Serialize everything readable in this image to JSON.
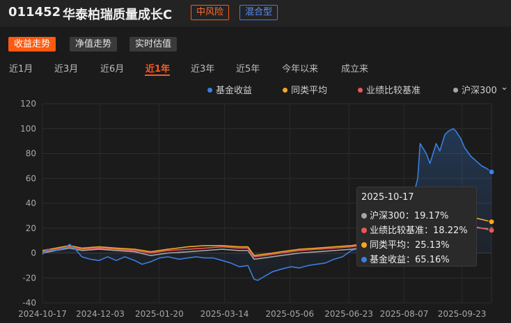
{
  "fund": {
    "code": "011452",
    "name": "华泰柏瑞质量成长C",
    "risk": "中风险",
    "type": "混合型"
  },
  "tabs": [
    "收益走势",
    "净值走势",
    "实时估值"
  ],
  "periods": [
    "近1月",
    "近3月",
    "近6月",
    "近1年",
    "近3年",
    "近5年",
    "今年以来",
    "成立来"
  ],
  "active_period": "近1年",
  "colors": {
    "fund": "#3a7fe0",
    "peer": "#f5a623",
    "benchmark": "#e85858",
    "hs300": "#a6a6a6",
    "accent": "#ff5a1f"
  },
  "tooltip": {
    "date": "2025-10-17",
    "rows": [
      {
        "label": "沪深300",
        "value": "19.17%",
        "color": "#a6a6a6"
      },
      {
        "label": "业绩比较基准",
        "value": "18.22%",
        "color": "#e85858"
      },
      {
        "label": "同类平均",
        "value": "25.13%",
        "color": "#f5a623"
      },
      {
        "label": "基金收益",
        "value": "65.16%",
        "color": "#3a7fe0"
      }
    ]
  },
  "chart_data": {
    "type": "line",
    "yticks": [
      "120",
      "100",
      "80",
      "60",
      "40",
      "20",
      "0",
      "-20",
      "-40"
    ],
    "xticks": [
      "2024-10-17",
      "2024-12-03",
      "2025-01-20",
      "2025-03-14",
      "2025-05-06",
      "2025-06-23",
      "2025-08-07",
      "2025-09-23"
    ],
    "ylim": [
      -40,
      120
    ],
    "xlim": [
      "2024-10-17",
      "2025-10-17"
    ],
    "grid": true,
    "legend_position": "top-right",
    "series": [
      {
        "name": "基金收益",
        "color": "#3a7fe0",
        "fill": true,
        "points": [
          [
            "2024-10-17",
            -1
          ],
          [
            "2024-10-21",
            3
          ],
          [
            "2024-10-28",
            2
          ],
          [
            "2024-11-04",
            4
          ],
          [
            "2024-11-08",
            7
          ],
          [
            "2024-11-13",
            3
          ],
          [
            "2024-11-18",
            -3
          ],
          [
            "2024-11-25",
            -5
          ],
          [
            "2024-12-02",
            -6
          ],
          [
            "2024-12-09",
            -3
          ],
          [
            "2024-12-16",
            -6
          ],
          [
            "2024-12-23",
            -3
          ],
          [
            "2024-12-31",
            -6
          ],
          [
            "2025-01-06",
            -9
          ],
          [
            "2025-01-13",
            -7
          ],
          [
            "2025-01-20",
            -4
          ],
          [
            "2025-01-27",
            -3
          ],
          [
            "2025-02-05",
            -5
          ],
          [
            "2025-02-12",
            -4
          ],
          [
            "2025-02-19",
            -3
          ],
          [
            "2025-02-26",
            -4
          ],
          [
            "2025-03-05",
            -4
          ],
          [
            "2025-03-12",
            -6
          ],
          [
            "2025-03-19",
            -8
          ],
          [
            "2025-03-26",
            -11
          ],
          [
            "2025-04-02",
            -10
          ],
          [
            "2025-04-07",
            -21
          ],
          [
            "2025-04-10",
            -22
          ],
          [
            "2025-04-15",
            -19
          ],
          [
            "2025-04-22",
            -15
          ],
          [
            "2025-04-29",
            -13
          ],
          [
            "2025-05-07",
            -11
          ],
          [
            "2025-05-14",
            -12
          ],
          [
            "2025-05-21",
            -10
          ],
          [
            "2025-05-28",
            -9
          ],
          [
            "2025-06-04",
            -8
          ],
          [
            "2025-06-11",
            -5
          ],
          [
            "2025-06-18",
            -3
          ],
          [
            "2025-06-25",
            2
          ],
          [
            "2025-07-02",
            4
          ],
          [
            "2025-07-09",
            6
          ],
          [
            "2025-07-16",
            8
          ],
          [
            "2025-07-23",
            12
          ],
          [
            "2025-07-30",
            18
          ],
          [
            "2025-08-06",
            28
          ],
          [
            "2025-08-13",
            40
          ],
          [
            "2025-08-18",
            60
          ],
          [
            "2025-08-20",
            88
          ],
          [
            "2025-08-25",
            80
          ],
          [
            "2025-08-28",
            72
          ],
          [
            "2025-09-02",
            88
          ],
          [
            "2025-09-05",
            82
          ],
          [
            "2025-09-09",
            95
          ],
          [
            "2025-09-12",
            98
          ],
          [
            "2025-09-16",
            100
          ],
          [
            "2025-09-18",
            98
          ],
          [
            "2025-09-22",
            92
          ],
          [
            "2025-09-25",
            85
          ],
          [
            "2025-09-30",
            78
          ],
          [
            "2025-10-09",
            70
          ],
          [
            "2025-10-13",
            68
          ],
          [
            "2025-10-17",
            65.16
          ]
        ]
      },
      {
        "name": "同类平均",
        "color": "#f5a623",
        "fill": false,
        "points": [
          [
            "2024-10-17",
            2
          ],
          [
            "2024-10-28",
            4
          ],
          [
            "2024-11-08",
            6
          ],
          [
            "2024-11-18",
            4
          ],
          [
            "2024-12-02",
            5
          ],
          [
            "2024-12-16",
            4
          ],
          [
            "2024-12-31",
            3
          ],
          [
            "2025-01-13",
            1
          ],
          [
            "2025-01-27",
            3
          ],
          [
            "2025-02-12",
            5
          ],
          [
            "2025-02-26",
            6
          ],
          [
            "2025-03-12",
            6
          ],
          [
            "2025-03-26",
            5
          ],
          [
            "2025-04-02",
            5
          ],
          [
            "2025-04-07",
            -2
          ],
          [
            "2025-04-15",
            -1
          ],
          [
            "2025-04-29",
            1
          ],
          [
            "2025-05-14",
            3
          ],
          [
            "2025-05-28",
            4
          ],
          [
            "2025-06-11",
            5
          ],
          [
            "2025-06-25",
            6
          ],
          [
            "2025-07-09",
            8
          ],
          [
            "2025-07-23",
            10
          ],
          [
            "2025-08-06",
            13
          ],
          [
            "2025-08-20",
            16
          ],
          [
            "2025-09-02",
            18
          ],
          [
            "2025-09-16",
            22
          ],
          [
            "2025-09-30",
            29
          ],
          [
            "2025-10-09",
            27
          ],
          [
            "2025-10-17",
            25.13
          ]
        ]
      },
      {
        "name": "业绩比较基准",
        "color": "#e85858",
        "fill": false,
        "points": [
          [
            "2024-10-17",
            1
          ],
          [
            "2024-10-28",
            3
          ],
          [
            "2024-11-08",
            5
          ],
          [
            "2024-11-18",
            3
          ],
          [
            "2024-12-02",
            4
          ],
          [
            "2024-12-16",
            3
          ],
          [
            "2024-12-31",
            2
          ],
          [
            "2025-01-13",
            0
          ],
          [
            "2025-01-27",
            2
          ],
          [
            "2025-02-12",
            3
          ],
          [
            "2025-02-26",
            4
          ],
          [
            "2025-03-12",
            5
          ],
          [
            "2025-03-26",
            4
          ],
          [
            "2025-04-02",
            4
          ],
          [
            "2025-04-07",
            -3
          ],
          [
            "2025-04-15",
            -2
          ],
          [
            "2025-04-29",
            0
          ],
          [
            "2025-05-14",
            2
          ],
          [
            "2025-05-28",
            3
          ],
          [
            "2025-06-11",
            4
          ],
          [
            "2025-06-25",
            5
          ],
          [
            "2025-07-09",
            7
          ],
          [
            "2025-07-23",
            9
          ],
          [
            "2025-08-06",
            11
          ],
          [
            "2025-08-20",
            14
          ],
          [
            "2025-09-02",
            16
          ],
          [
            "2025-09-16",
            19
          ],
          [
            "2025-09-30",
            22
          ],
          [
            "2025-10-09",
            20
          ],
          [
            "2025-10-17",
            18.22
          ]
        ]
      },
      {
        "name": "沪深300",
        "color": "#a6a6a6",
        "fill": false,
        "points": [
          [
            "2024-10-17",
            0
          ],
          [
            "2024-10-28",
            2
          ],
          [
            "2024-11-08",
            4
          ],
          [
            "2024-11-18",
            2
          ],
          [
            "2024-12-02",
            3
          ],
          [
            "2024-12-16",
            2
          ],
          [
            "2024-12-31",
            1
          ],
          [
            "2025-01-13",
            -2
          ],
          [
            "2025-01-27",
            0
          ],
          [
            "2025-02-12",
            1
          ],
          [
            "2025-02-26",
            2
          ],
          [
            "2025-03-12",
            3
          ],
          [
            "2025-03-26",
            2
          ],
          [
            "2025-04-02",
            2
          ],
          [
            "2025-04-07",
            -5
          ],
          [
            "2025-04-15",
            -4
          ],
          [
            "2025-04-29",
            -2
          ],
          [
            "2025-05-14",
            0
          ],
          [
            "2025-05-28",
            1
          ],
          [
            "2025-06-11",
            2
          ],
          [
            "2025-06-25",
            3
          ],
          [
            "2025-07-09",
            5
          ],
          [
            "2025-07-23",
            7
          ],
          [
            "2025-08-06",
            10
          ],
          [
            "2025-08-20",
            13
          ],
          [
            "2025-09-02",
            15
          ],
          [
            "2025-09-16",
            18
          ],
          [
            "2025-09-30",
            21
          ],
          [
            "2025-10-09",
            20
          ],
          [
            "2025-10-17",
            19.17
          ]
        ]
      }
    ]
  }
}
